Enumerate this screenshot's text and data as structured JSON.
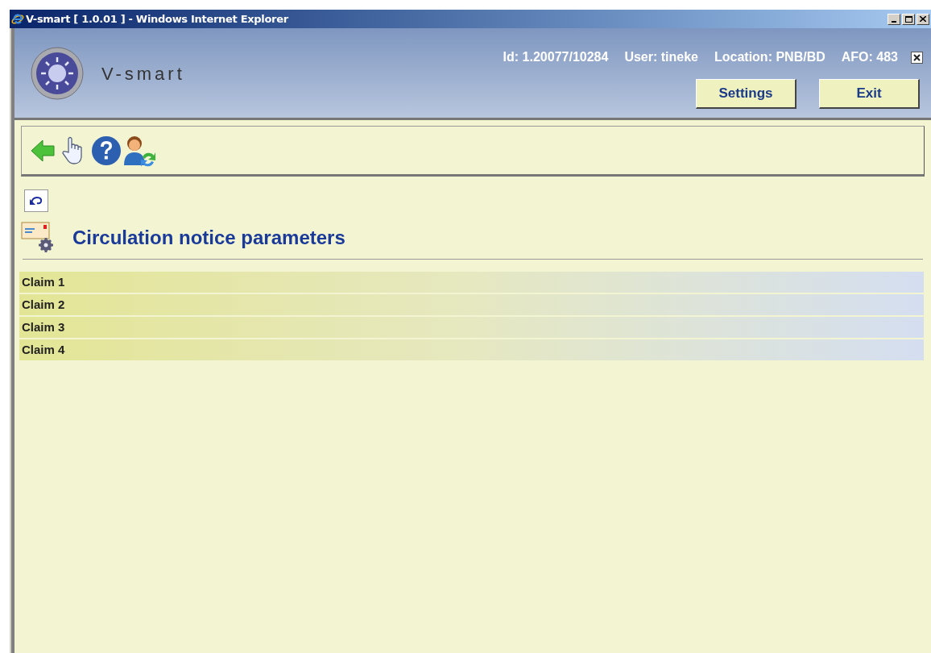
{
  "window": {
    "title": "V-smart [ 1.0.01 ] - Windows Internet Explorer"
  },
  "header": {
    "brand": "V-smart",
    "info": [
      "Id: 1.20077/10284",
      "User: tineke",
      "Location: PNB/BD",
      "AFO: 483"
    ],
    "buttons": [
      "Settings",
      "Exit"
    ]
  },
  "page": {
    "title": "Circulation notice parameters"
  },
  "rows": [
    {
      "label": "Claim 1"
    },
    {
      "label": "Claim 2"
    },
    {
      "label": "Claim 3"
    },
    {
      "label": "Claim 4"
    }
  ]
}
